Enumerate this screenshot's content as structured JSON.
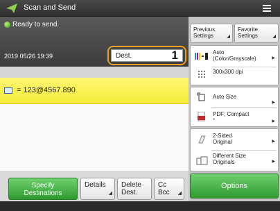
{
  "titlebar": {
    "title": "Scan and Send",
    "menu_icon": "hamburger-menu-icon"
  },
  "status": {
    "text": "Ready to send.",
    "datetime": "2019 05/26 19:39",
    "indicator_color": "#4caf2a"
  },
  "destination_box": {
    "label": "Dest.",
    "count": "1",
    "highlight_color": "#f0a020"
  },
  "destination_list": [
    {
      "icon": "email-icon",
      "address": "= 123@4567.890"
    }
  ],
  "actions": {
    "specify_line1": "Specify",
    "specify_line2": "Destinations",
    "details": "Details",
    "delete_line1": "Delete",
    "delete_line2": "Dest.",
    "cc_line1": "Cc",
    "cc_line2": "Bcc"
  },
  "tabs": {
    "previous_line1": "Previous",
    "previous_line2": "Settings",
    "favorite_line1": "Favorite",
    "favorite_line2": "Settings"
  },
  "settings": {
    "color_line1": "Auto",
    "color_line2": "(Color/Grayscale)",
    "resolution": "300x300 dpi",
    "size": "Auto Size",
    "format_line1": "PDF; Compact",
    "format_line2": "*",
    "sided_line1": "2-Sided",
    "sided_line2": "Original",
    "mixed_line1": "Different Size",
    "mixed_line2": "Originals"
  },
  "options_label": "Options",
  "accent_green": "#3aa83a"
}
